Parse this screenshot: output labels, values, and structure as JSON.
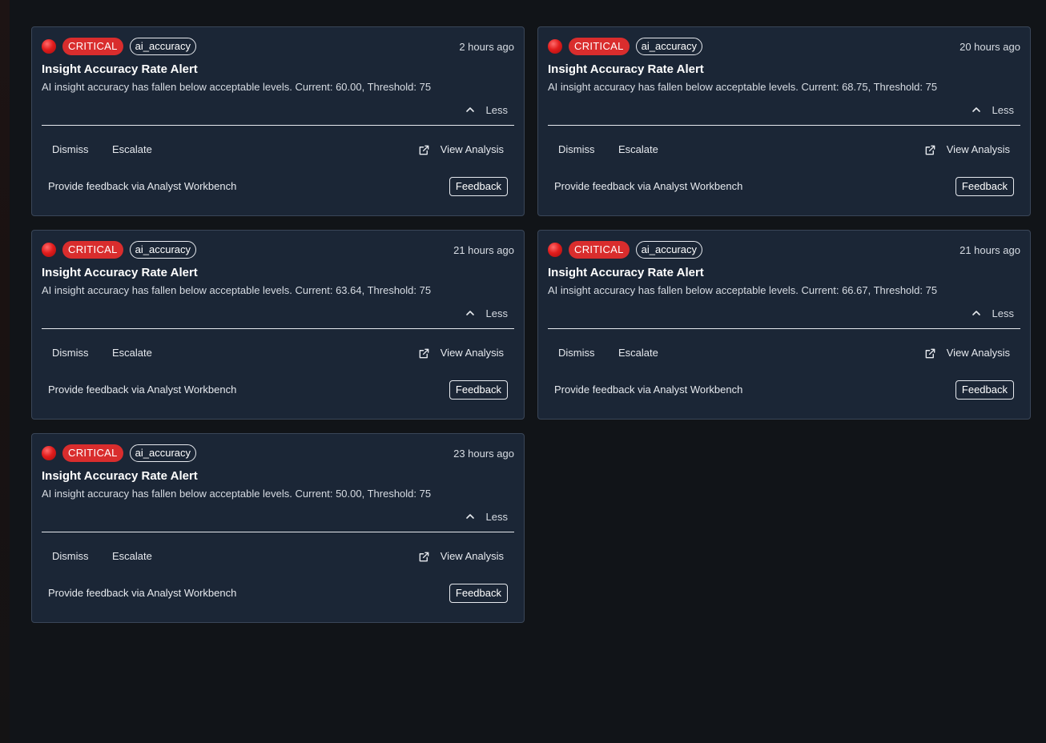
{
  "colors": {
    "page_background": "#111418",
    "card_background": "#1b2636",
    "critical_badge": "#d92d2d",
    "status_dot": "#e11d1d"
  },
  "icons": {
    "status": "red-circle-icon",
    "collapse": "chevron-up-icon",
    "view_analysis": "external-link-icon"
  },
  "alerts": [
    {
      "severity": "CRITICAL",
      "tag": "ai_accuracy",
      "time": "2 hours ago",
      "title": "Insight Accuracy Rate Alert",
      "description": "AI insight accuracy has fallen below acceptable levels. Current: 60.00, Threshold: 75",
      "less_label": "Less",
      "dismiss_label": "Dismiss",
      "escalate_label": "Escalate",
      "view_label": "View Analysis",
      "feedback_text": "Provide feedback via Analyst Workbench",
      "feedback_label": "Feedback"
    },
    {
      "severity": "CRITICAL",
      "tag": "ai_accuracy",
      "time": "20 hours ago",
      "title": "Insight Accuracy Rate Alert",
      "description": "AI insight accuracy has fallen below acceptable levels. Current: 68.75, Threshold: 75",
      "less_label": "Less",
      "dismiss_label": "Dismiss",
      "escalate_label": "Escalate",
      "view_label": "View Analysis",
      "feedback_text": "Provide feedback via Analyst Workbench",
      "feedback_label": "Feedback"
    },
    {
      "severity": "CRITICAL",
      "tag": "ai_accuracy",
      "time": "21 hours ago",
      "title": "Insight Accuracy Rate Alert",
      "description": "AI insight accuracy has fallen below acceptable levels. Current: 63.64, Threshold: 75",
      "less_label": "Less",
      "dismiss_label": "Dismiss",
      "escalate_label": "Escalate",
      "view_label": "View Analysis",
      "feedback_text": "Provide feedback via Analyst Workbench",
      "feedback_label": "Feedback"
    },
    {
      "severity": "CRITICAL",
      "tag": "ai_accuracy",
      "time": "21 hours ago",
      "title": "Insight Accuracy Rate Alert",
      "description": "AI insight accuracy has fallen below acceptable levels. Current: 66.67, Threshold: 75",
      "less_label": "Less",
      "dismiss_label": "Dismiss",
      "escalate_label": "Escalate",
      "view_label": "View Analysis",
      "feedback_text": "Provide feedback via Analyst Workbench",
      "feedback_label": "Feedback"
    },
    {
      "severity": "CRITICAL",
      "tag": "ai_accuracy",
      "time": "23 hours ago",
      "title": "Insight Accuracy Rate Alert",
      "description": "AI insight accuracy has fallen below acceptable levels. Current: 50.00, Threshold: 75",
      "less_label": "Less",
      "dismiss_label": "Dismiss",
      "escalate_label": "Escalate",
      "view_label": "View Analysis",
      "feedback_text": "Provide feedback via Analyst Workbench",
      "feedback_label": "Feedback"
    }
  ]
}
